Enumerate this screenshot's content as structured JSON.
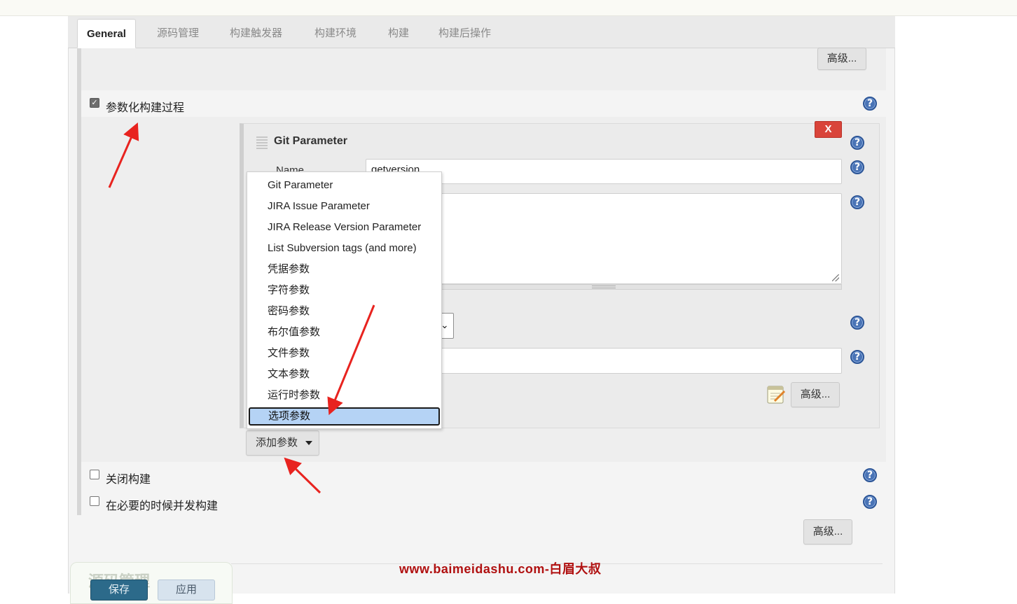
{
  "tabs": [
    "General",
    "源码管理",
    "构建触发器",
    "构建环境",
    "构建",
    "构建后操作"
  ],
  "advanced_label": "高级...",
  "help_glyph": "?",
  "checkbox_glyph": "✓",
  "parameterized": {
    "label": "参数化构建过程",
    "checked": true
  },
  "git_parameter": {
    "title": "Git Parameter",
    "remove_label": "X",
    "name_label": "Name",
    "name_value": "getversion"
  },
  "add_param_label": "添加参数",
  "param_menu": {
    "items": [
      "Git Parameter",
      "JIRA Issue Parameter",
      "JIRA Release Version Parameter",
      "List Subversion tags (and more)",
      "凭据参数",
      "字符参数",
      "密码参数",
      "布尔值参数",
      "文件参数",
      "文本参数",
      "运行时参数"
    ],
    "selected": "选项参数"
  },
  "disable_build": {
    "label": "关闭构建",
    "checked": false
  },
  "concurrent_build": {
    "label": "在必要的时候并发构建",
    "checked": false
  },
  "watermark": "www.baimeidashu.com-白眉大叔",
  "bottom": {
    "section_title": "源码管理",
    "save_label": "保存",
    "apply_label": "应用"
  },
  "colors": {
    "remove_button": "#d9443a",
    "help_icon": "#4a74b6",
    "selected_item": "#b5d3f5",
    "watermark": "#b01010"
  }
}
